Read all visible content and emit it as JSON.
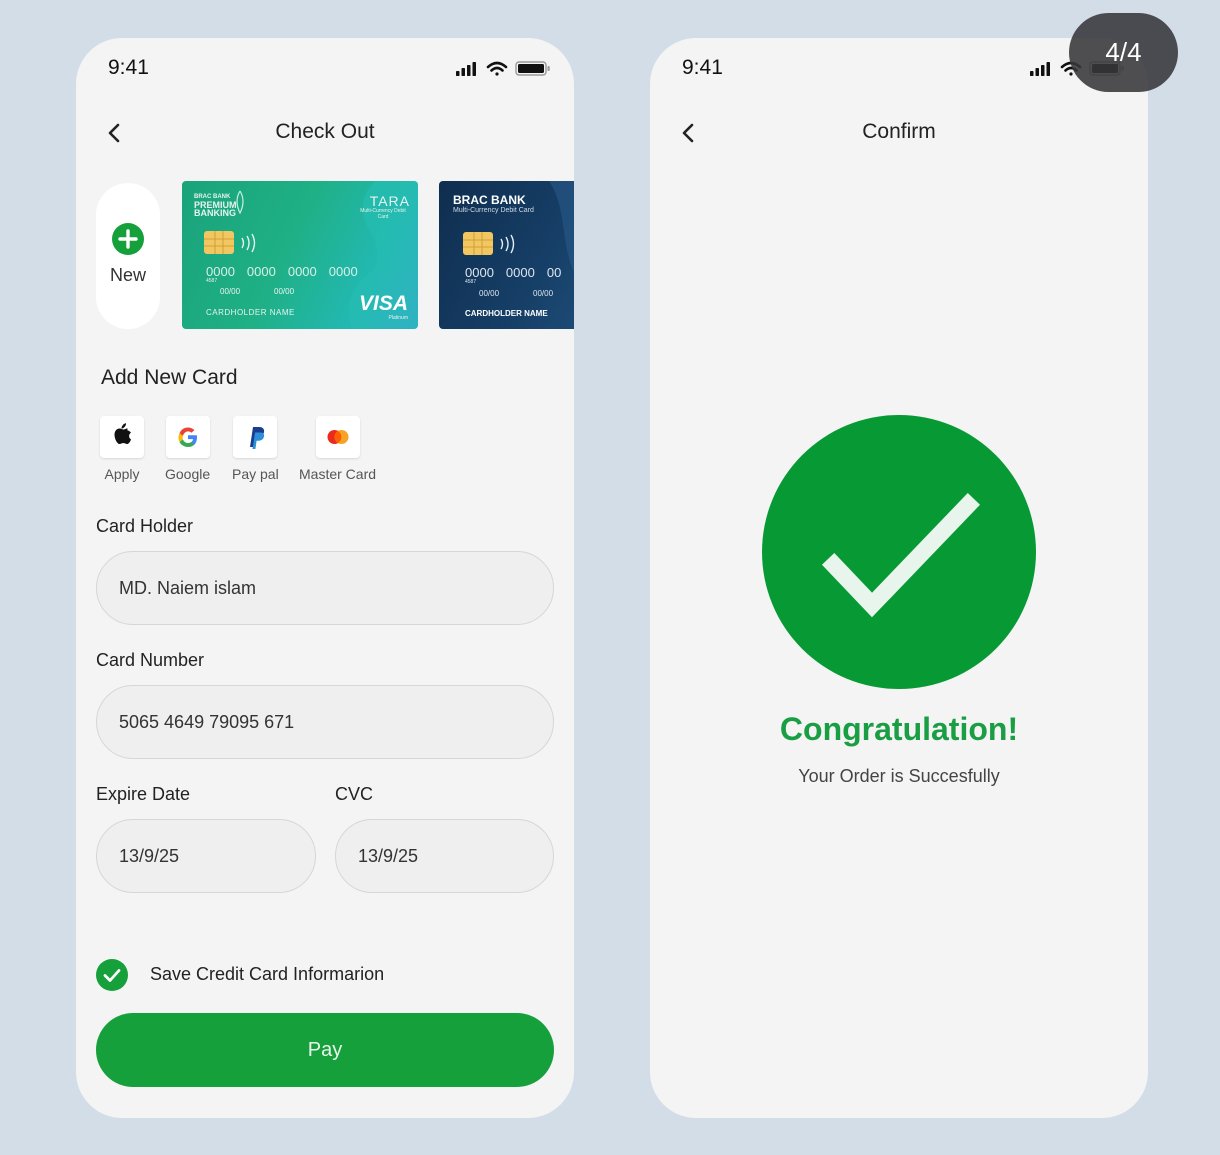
{
  "checkout": {
    "status_time": "9:41",
    "title": "Check Out",
    "new_card_label": "New",
    "cards": {
      "green": {
        "bank": "BRAC BANK",
        "tier": "PREMIUM BANKING",
        "brand": "TARA",
        "brand_sub": "Multi-Currency Debit Card",
        "number_groups": [
          "0000",
          "0000",
          "0000",
          "0000"
        ],
        "small_number": "4587",
        "valid_from": "00/00",
        "valid_thru": "00/00",
        "holder": "CARDHOLDER NAME",
        "network": "VISA",
        "network_sub": "Platinum"
      },
      "blue": {
        "bank": "BRAC BANK",
        "subtitle": "Multi-Currency Debit Card",
        "number_groups": [
          "0000",
          "0000",
          "00"
        ],
        "small_number": "4587",
        "valid_from": "00/00",
        "valid_thru": "00/00",
        "holder": "CARDHOLDER NAME"
      }
    },
    "add_new_card_title": "Add New Card",
    "payment_methods": [
      "Apply",
      "Google",
      "Pay pal",
      "Master Card"
    ],
    "card_holder": {
      "label": "Card Holder",
      "value": "MD. Naiem islam"
    },
    "card_number": {
      "label": "Card Number",
      "value": "5065 4649 79095 671"
    },
    "expire_date": {
      "label": "Expire Date",
      "value": "13/9/25"
    },
    "cvc": {
      "label": "CVC",
      "value": "13/9/25"
    },
    "save_label": "Save Credit Card Informarion",
    "save_checked": true,
    "pay_label": "Pay"
  },
  "confirm": {
    "status_time": "9:41",
    "title": "Confirm",
    "congrats": "Congratulation!",
    "message": "Your Order is Succesfully"
  },
  "page_counter": "4/4",
  "colors": {
    "accent_green": "#15a03c",
    "congrats_green": "#1a9e44",
    "background": "#d3dde8",
    "screen": "#f4f4f4"
  },
  "icons": [
    "signal-icon",
    "wifi-icon",
    "battery-icon",
    "back-chevron-icon",
    "plus-circle-icon",
    "apple-icon",
    "google-icon",
    "paypal-icon",
    "mastercard-icon",
    "check-circle-icon",
    "success-check-icon"
  ]
}
